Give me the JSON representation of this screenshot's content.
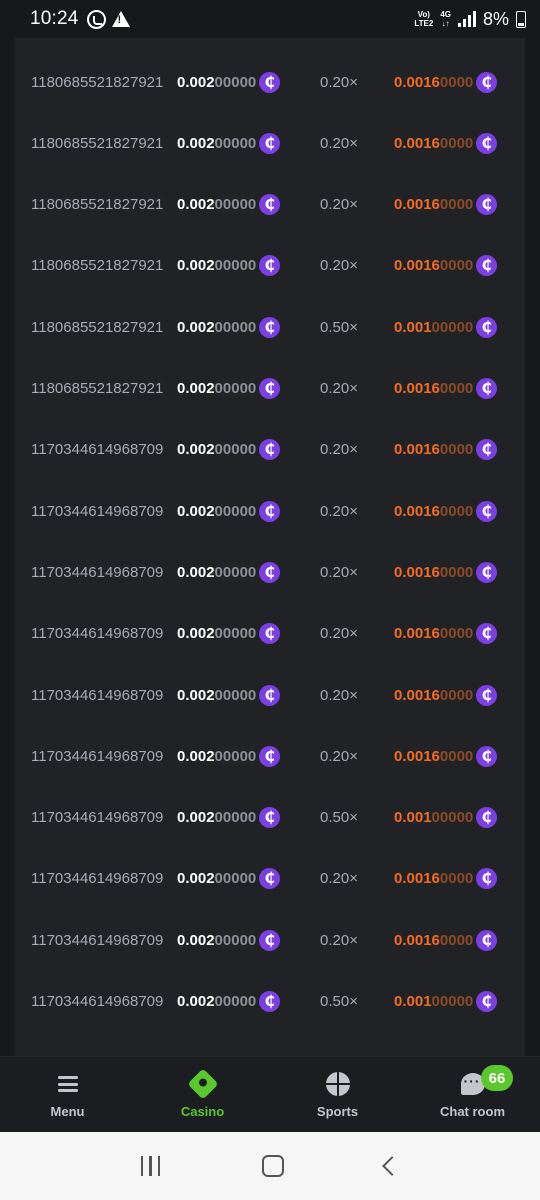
{
  "status_bar": {
    "time": "10:24",
    "volte_line1": "Vo)",
    "volte_line2": "LTE2",
    "net_line1": "4G",
    "net_line2": "↓↑",
    "battery": "8%"
  },
  "coin_glyph": "₵",
  "colors": {
    "coin": "#7b3fe4",
    "payout_accent": "#f36c23",
    "active_nav": "#5bc72e"
  },
  "bets": [
    {
      "id": "1180685521827921",
      "amount_bright": "0.002",
      "amount_dim": "00000",
      "multiplier": "0.20×",
      "payout_bright": "0.0016",
      "payout_dim": "0000"
    },
    {
      "id": "1180685521827921",
      "amount_bright": "0.002",
      "amount_dim": "00000",
      "multiplier": "0.20×",
      "payout_bright": "0.0016",
      "payout_dim": "0000"
    },
    {
      "id": "1180685521827921",
      "amount_bright": "0.002",
      "amount_dim": "00000",
      "multiplier": "0.20×",
      "payout_bright": "0.0016",
      "payout_dim": "0000"
    },
    {
      "id": "1180685521827921",
      "amount_bright": "0.002",
      "amount_dim": "00000",
      "multiplier": "0.20×",
      "payout_bright": "0.0016",
      "payout_dim": "0000"
    },
    {
      "id": "1180685521827921",
      "amount_bright": "0.002",
      "amount_dim": "00000",
      "multiplier": "0.50×",
      "payout_bright": "0.001",
      "payout_dim": "00000"
    },
    {
      "id": "1180685521827921",
      "amount_bright": "0.002",
      "amount_dim": "00000",
      "multiplier": "0.20×",
      "payout_bright": "0.0016",
      "payout_dim": "0000"
    },
    {
      "id": "1170344614968709",
      "amount_bright": "0.002",
      "amount_dim": "00000",
      "multiplier": "0.20×",
      "payout_bright": "0.0016",
      "payout_dim": "0000"
    },
    {
      "id": "1170344614968709",
      "amount_bright": "0.002",
      "amount_dim": "00000",
      "multiplier": "0.20×",
      "payout_bright": "0.0016",
      "payout_dim": "0000"
    },
    {
      "id": "1170344614968709",
      "amount_bright": "0.002",
      "amount_dim": "00000",
      "multiplier": "0.20×",
      "payout_bright": "0.0016",
      "payout_dim": "0000"
    },
    {
      "id": "1170344614968709",
      "amount_bright": "0.002",
      "amount_dim": "00000",
      "multiplier": "0.20×",
      "payout_bright": "0.0016",
      "payout_dim": "0000"
    },
    {
      "id": "1170344614968709",
      "amount_bright": "0.002",
      "amount_dim": "00000",
      "multiplier": "0.20×",
      "payout_bright": "0.0016",
      "payout_dim": "0000"
    },
    {
      "id": "1170344614968709",
      "amount_bright": "0.002",
      "amount_dim": "00000",
      "multiplier": "0.20×",
      "payout_bright": "0.0016",
      "payout_dim": "0000"
    },
    {
      "id": "1170344614968709",
      "amount_bright": "0.002",
      "amount_dim": "00000",
      "multiplier": "0.50×",
      "payout_bright": "0.001",
      "payout_dim": "00000"
    },
    {
      "id": "1170344614968709",
      "amount_bright": "0.002",
      "amount_dim": "00000",
      "multiplier": "0.20×",
      "payout_bright": "0.0016",
      "payout_dim": "0000"
    },
    {
      "id": "1170344614968709",
      "amount_bright": "0.002",
      "amount_dim": "00000",
      "multiplier": "0.20×",
      "payout_bright": "0.0016",
      "payout_dim": "0000"
    },
    {
      "id": "1170344614968709",
      "amount_bright": "0.002",
      "amount_dim": "00000",
      "multiplier": "0.50×",
      "payout_bright": "0.001",
      "payout_dim": "00000"
    }
  ],
  "bottom_nav": {
    "menu": "Menu",
    "casino": "Casino",
    "sports": "Sports",
    "chat": "Chat room",
    "chat_badge": "66",
    "active": "casino"
  }
}
